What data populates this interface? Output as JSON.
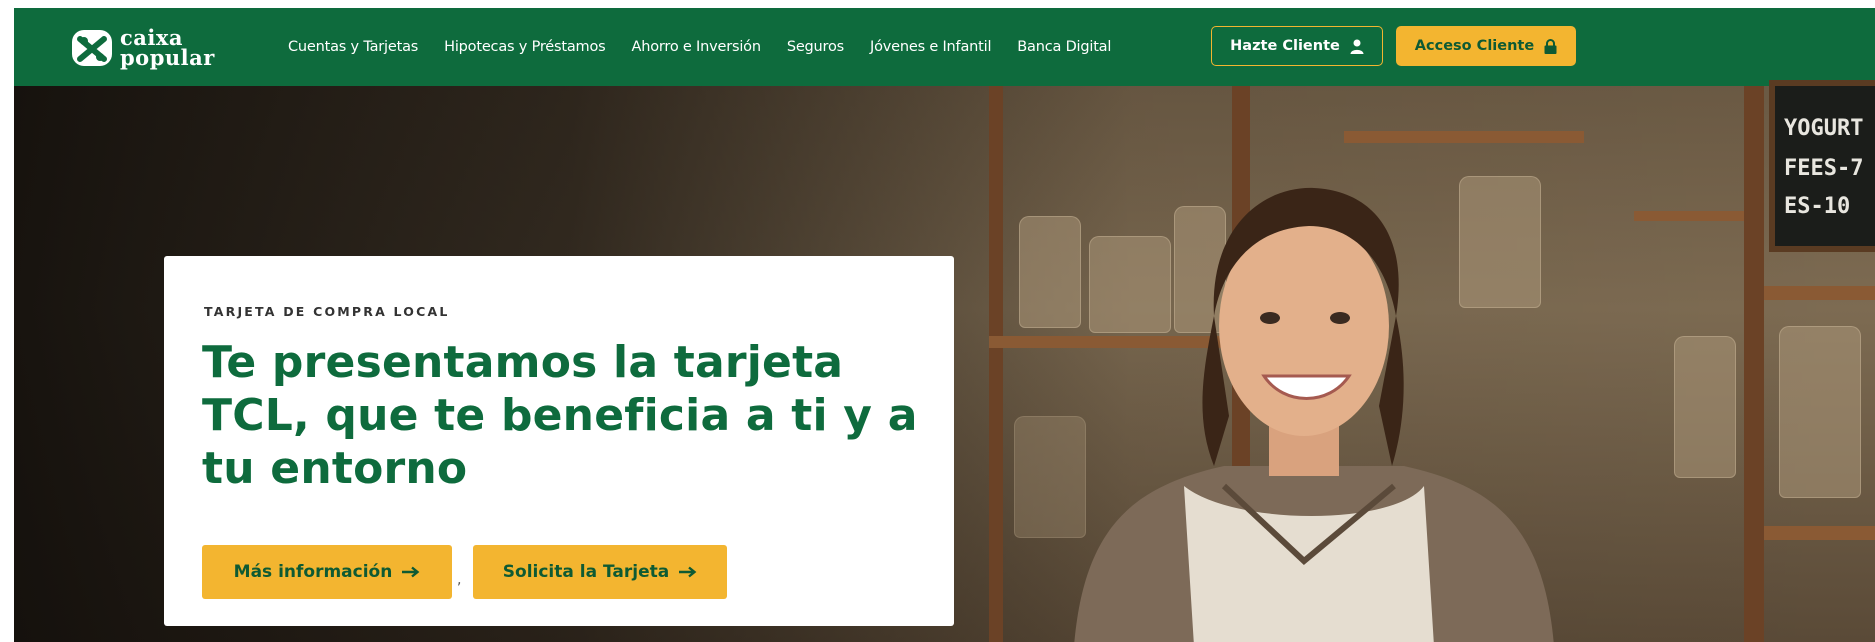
{
  "brand": {
    "line1": "caixa",
    "line2": "popular"
  },
  "nav": {
    "items": [
      {
        "label": "Cuentas y Tarjetas"
      },
      {
        "label": "Hipotecas y Préstamos"
      },
      {
        "label": "Ahorro e Inversión"
      },
      {
        "label": "Seguros"
      },
      {
        "label": "Jóvenes e Infantil"
      },
      {
        "label": "Banca Digital"
      }
    ],
    "hazte_cliente": "Hazte Cliente",
    "acceso_cliente": "Acceso Cliente"
  },
  "hero": {
    "eyebrow": "TARJETA DE COMPRA LOCAL",
    "headline": "Te presentamos la tarjeta TCL, que te beneficia a ti y a tu entorno",
    "cta_primary": "Más información",
    "separator": ",",
    "cta_secondary": "Solicita la Tarjeta",
    "chalkboard": [
      "YOGURT",
      "FEES-7",
      "ES-10"
    ]
  },
  "colors": {
    "brand_green": "#0e6b3d",
    "accent_yellow": "#f3b530"
  }
}
